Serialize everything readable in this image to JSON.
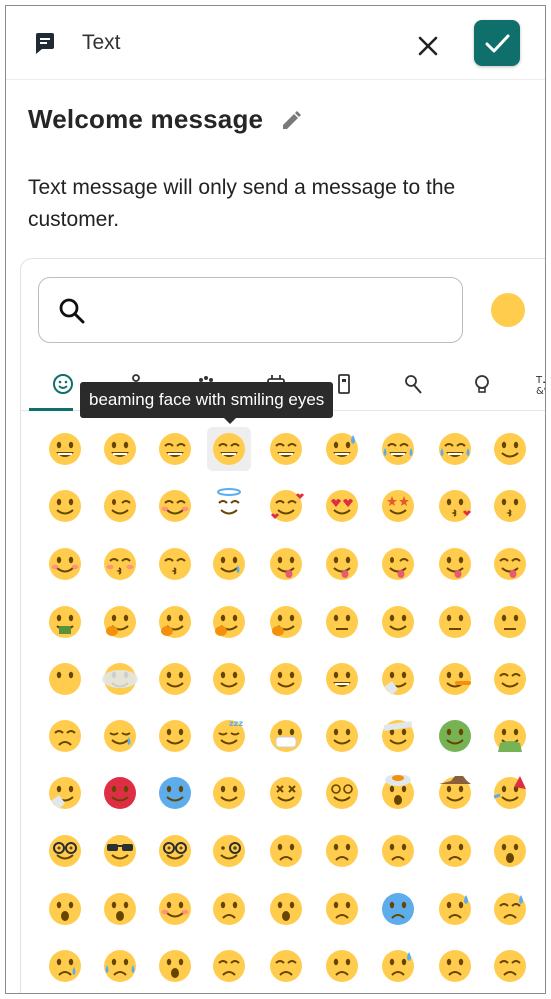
{
  "header": {
    "title": "Text",
    "icon": "message-icon",
    "close_icon": "close-icon",
    "confirm_icon": "check-icon",
    "accent": "#0f6f6a"
  },
  "title": "Welcome message",
  "description": "Text message will only send a message to the customer.",
  "picker": {
    "search_placeholder": "",
    "skin_tone_color": "#FFCC4D",
    "categories": [
      {
        "name": "smileys",
        "icon": "smiley-icon",
        "active": true
      },
      {
        "name": "people",
        "icon": "person-icon",
        "active": false
      },
      {
        "name": "animals",
        "icon": "paw-icon",
        "active": false
      },
      {
        "name": "food",
        "icon": "food-icon",
        "active": false
      },
      {
        "name": "travel",
        "icon": "building-icon",
        "active": false
      },
      {
        "name": "activities",
        "icon": "medal-icon",
        "active": false
      },
      {
        "name": "objects",
        "icon": "bulb-icon",
        "active": false
      },
      {
        "name": "symbols",
        "icon": "symbols-icon",
        "active": false
      }
    ],
    "tooltip": "beaming face with smiling eyes",
    "hovered_index": 3,
    "emojis": [
      "grinning-face",
      "grinning-face-with-big-eyes",
      "grinning-face-with-smiling-eyes",
      "beaming-face-with-smiling-eyes",
      "grinning-squinting-face",
      "grinning-face-with-sweat",
      "rolling-on-the-floor-laughing",
      "face-with-tears-of-joy",
      "slightly-smiling-face",
      "upside-down-face",
      "winking-face",
      "smiling-face-with-smiling-eyes",
      "smiling-face-with-halo",
      "smiling-face-with-hearts",
      "smiling-face-with-heart-eyes",
      "star-struck",
      "face-blowing-a-kiss",
      "kissing-face",
      "smiling-face",
      "kissing-face-with-closed-eyes",
      "kissing-face-with-smiling-eyes",
      "smiling-face-with-tear",
      "face-savoring-food",
      "face-with-tongue",
      "winking-face-with-tongue",
      "zany-face",
      "squinting-face-with-tongue",
      "money-mouth-face",
      "hugging-face",
      "face-with-hand-over-mouth",
      "shushing-face",
      "thinking-face",
      "zipper-mouth-face",
      "face-with-raised-eyebrow",
      "neutral-face",
      "expressionless-face",
      "face-without-mouth",
      "face-in-clouds",
      "smirking-face",
      "unamused-face",
      "face-with-rolling-eyes",
      "grimacing-face",
      "face-exhaling",
      "lying-face",
      "relieved-face",
      "pensive-face",
      "sleepy-face",
      "drooling-face",
      "sleeping-face",
      "face-with-medical-mask",
      "face-with-thermometer",
      "face-with-head-bandage",
      "nauseated-face",
      "face-vomiting",
      "sneezing-face",
      "hot-face",
      "cold-face",
      "woozy-face",
      "face-with-crossed-out-eyes",
      "face-with-spiral-eyes",
      "exploding-head",
      "cowboy-hat-face",
      "partying-face",
      "disguised-face",
      "smiling-face-with-sunglasses",
      "nerd-face",
      "face-with-monocle",
      "confused-face",
      "worried-face",
      "slightly-frowning-face",
      "frowning-face",
      "face-with-open-mouth",
      "hushed-face",
      "astonished-face",
      "flushed-face",
      "pleading-face",
      "frowning-face-with-open-mouth",
      "anguished-face",
      "fearful-face",
      "anxious-face-with-sweat",
      "sad-but-relieved-face",
      "crying-face",
      "loudly-crying-face",
      "face-screaming-in-fear",
      "confounded-face",
      "persevering-face",
      "disappointed-face",
      "downcast-face-with-sweat",
      "weary-face",
      "tired-face"
    ]
  }
}
